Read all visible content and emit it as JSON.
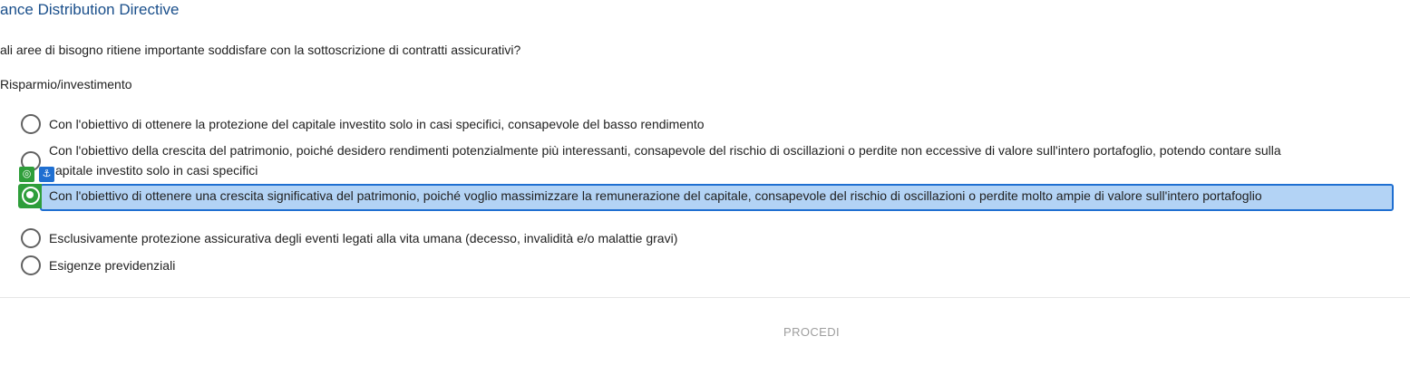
{
  "header": {
    "title": "ance Distribution Directive"
  },
  "question": {
    "text": "ali aree di bisogno ritiene importante soddisfare con la sottoscrizione di contratti assicurativi?"
  },
  "category": {
    "label": "Risparmio/investimento"
  },
  "options": [
    {
      "label": "Con l'obiettivo di ottenere la protezione del capitale investito solo in casi specifici, consapevole del basso rendimento",
      "selected": false
    },
    {
      "label_line1": "Con l'obiettivo della crescita del patrimonio, poiché desidero rendimenti potenzialmente più interessanti, consapevole del rischio di oscillazioni o perdite non eccessive di valore sull'intero portafoglio, potendo contare sulla",
      "label_line2": "apitale investito solo in casi specifici",
      "selected": false
    },
    {
      "label": "Con l'obiettivo di ottenere una crescita significativa del patrimonio, poiché voglio massimizzare la remunerazione del capitale, consapevole del rischio di oscillazioni o perdite molto ampie di valore sull'intero portafoglio",
      "selected": false,
      "highlighted": true
    },
    {
      "label": "Esclusivamente protezione assicurativa degli eventi legati alla vita umana (decesso, invalidità e/o malattie gravi)",
      "selected": false
    },
    {
      "label": "Esigenze previdenziali",
      "selected": false
    }
  ],
  "overlay": {
    "badges": [
      "target-icon",
      "anchor-icon"
    ]
  },
  "footer": {
    "procedi_label": "PROCEDI"
  },
  "colors": {
    "title": "#1a4f8b",
    "highlight_fill": "#b3d3f5",
    "highlight_border": "#1f6fd1",
    "overlay_green": "#2e9e3a",
    "button_disabled": "#9e9e9e"
  }
}
